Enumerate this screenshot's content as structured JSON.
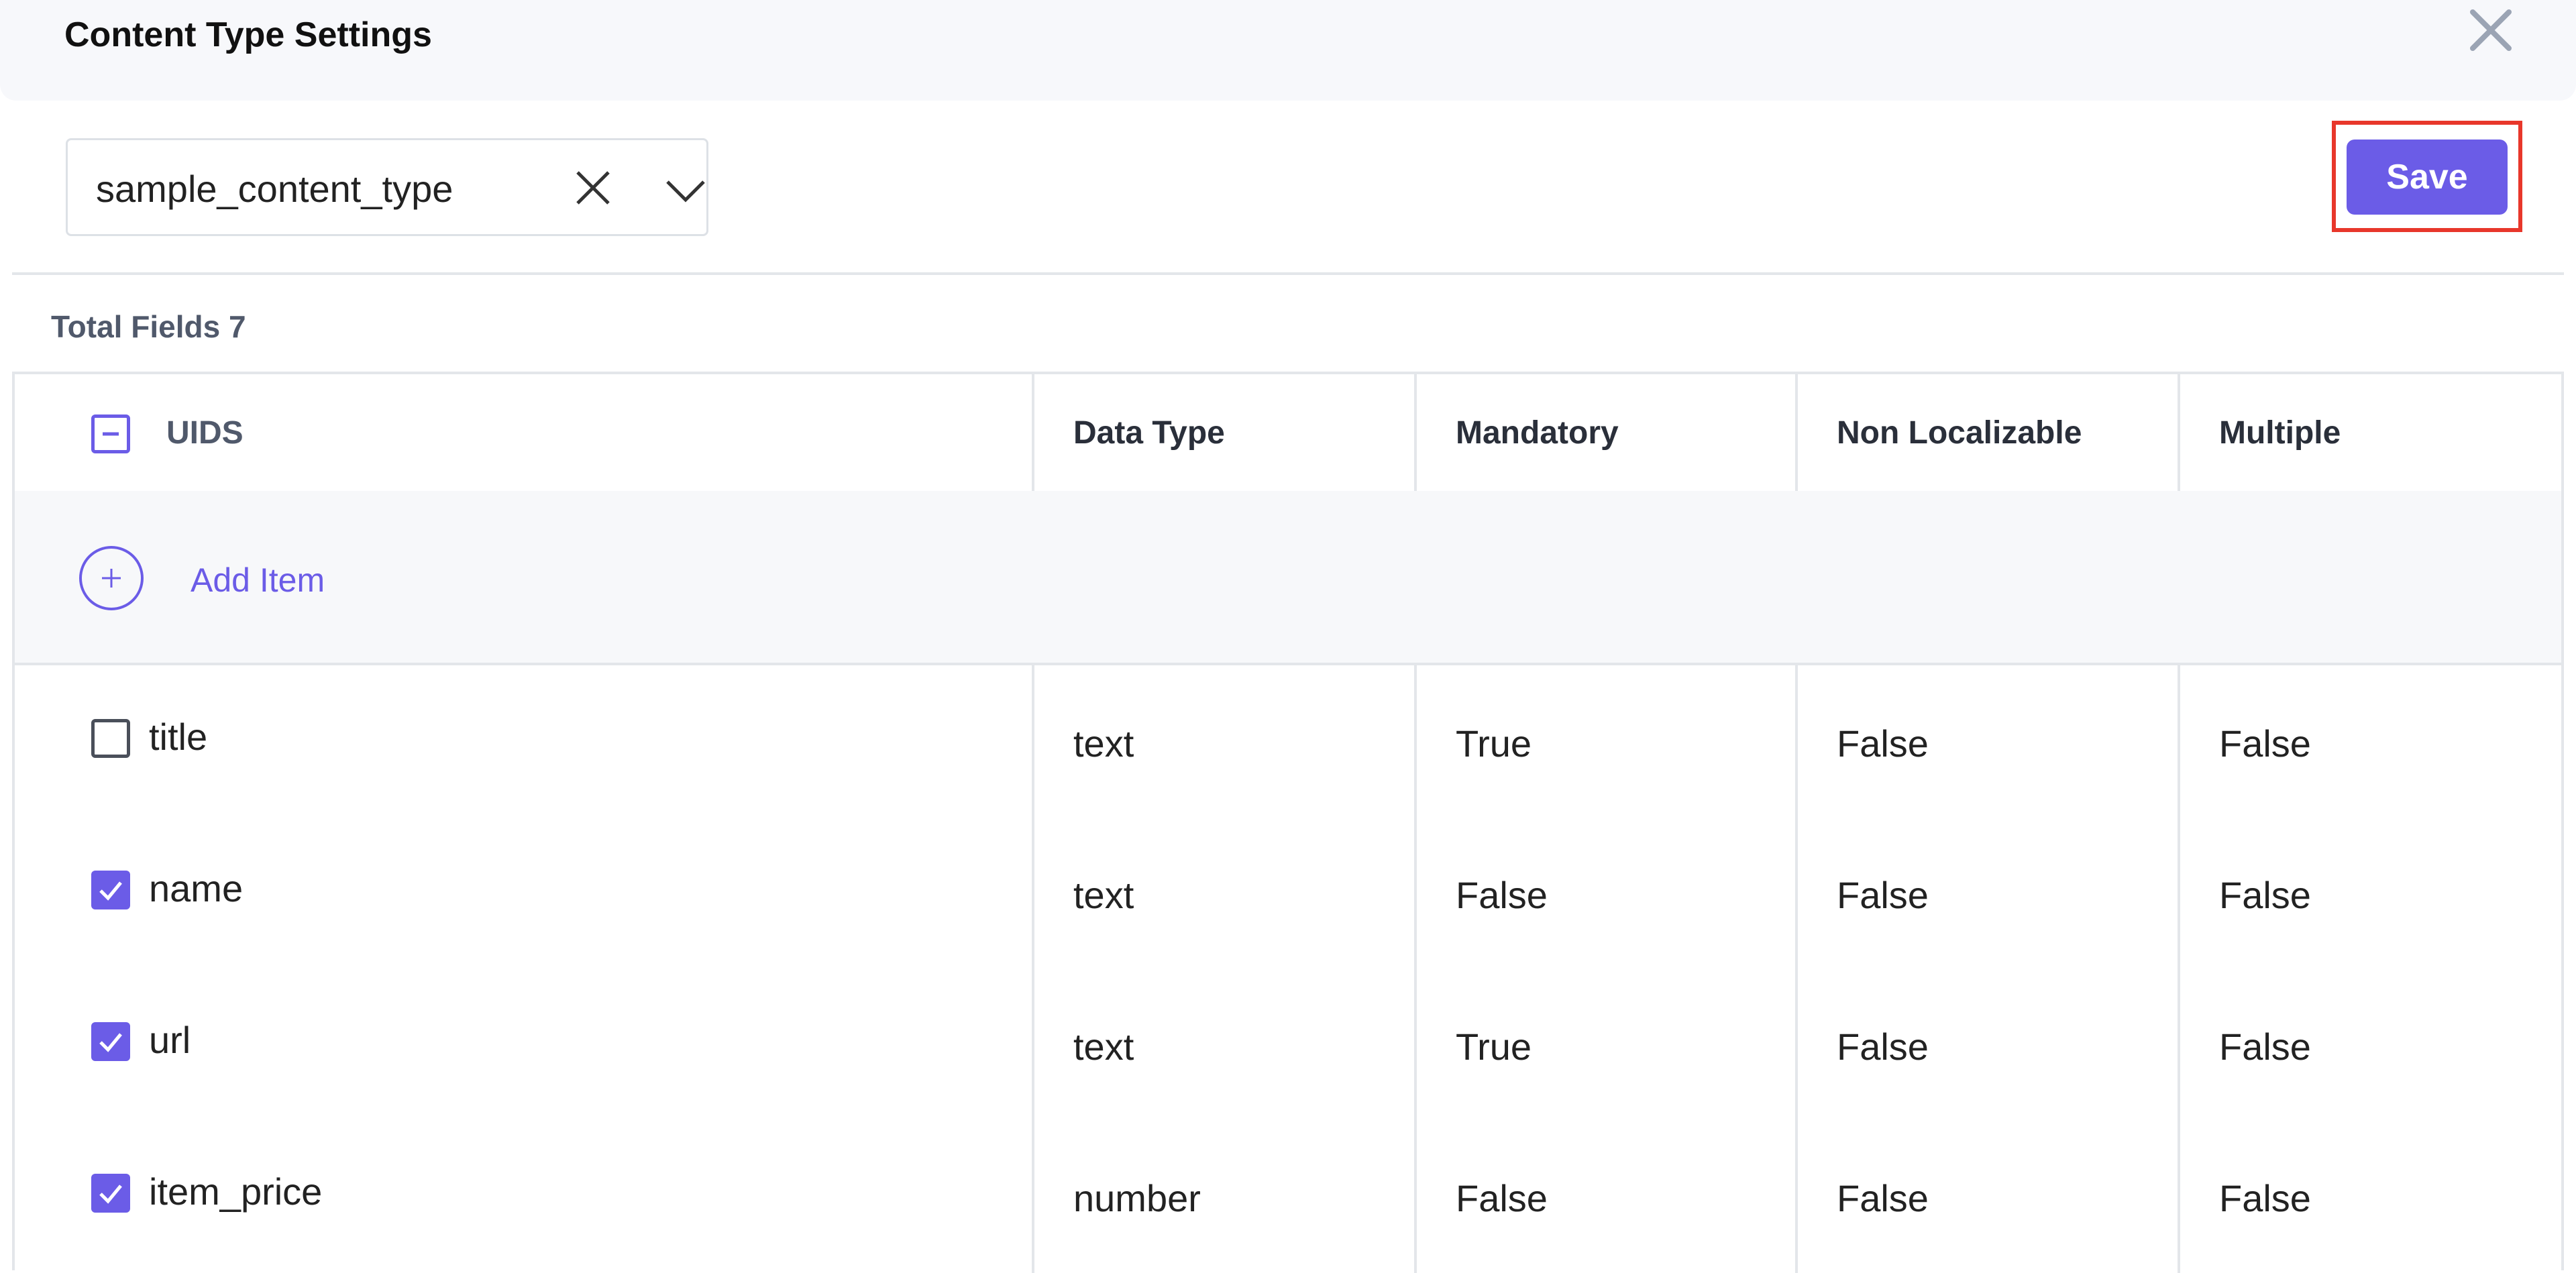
{
  "header": {
    "title": "Content Type Settings"
  },
  "selector": {
    "value": "sample_content_type"
  },
  "toolbar": {
    "save_label": "Save"
  },
  "summary": {
    "total_fields_label": "Total Fields 7"
  },
  "table": {
    "columns": [
      "UIDS",
      "Data Type",
      "Mandatory",
      "Non Localizable",
      "Multiple"
    ],
    "add_item_label": "Add Item",
    "rows": [
      {
        "uid": "title",
        "checked": false,
        "data_type": "text",
        "mandatory": "True",
        "non_localizable": "False",
        "multiple": "False"
      },
      {
        "uid": "name",
        "checked": true,
        "data_type": "text",
        "mandatory": "False",
        "non_localizable": "False",
        "multiple": "False"
      },
      {
        "uid": "url",
        "checked": true,
        "data_type": "text",
        "mandatory": "True",
        "non_localizable": "False",
        "multiple": "False"
      },
      {
        "uid": "item_price",
        "checked": true,
        "data_type": "number",
        "mandatory": "False",
        "non_localizable": "False",
        "multiple": "False"
      }
    ]
  },
  "colors": {
    "accent": "#6b5ce7",
    "highlight": "#e8372b",
    "border": "#e3e6ea"
  },
  "icons": {
    "close": "close-icon",
    "clear": "clear-icon",
    "dropdown": "chevron-down-icon",
    "add": "plus-circle-icon",
    "check": "check-icon",
    "indeterminate": "minus-icon"
  }
}
